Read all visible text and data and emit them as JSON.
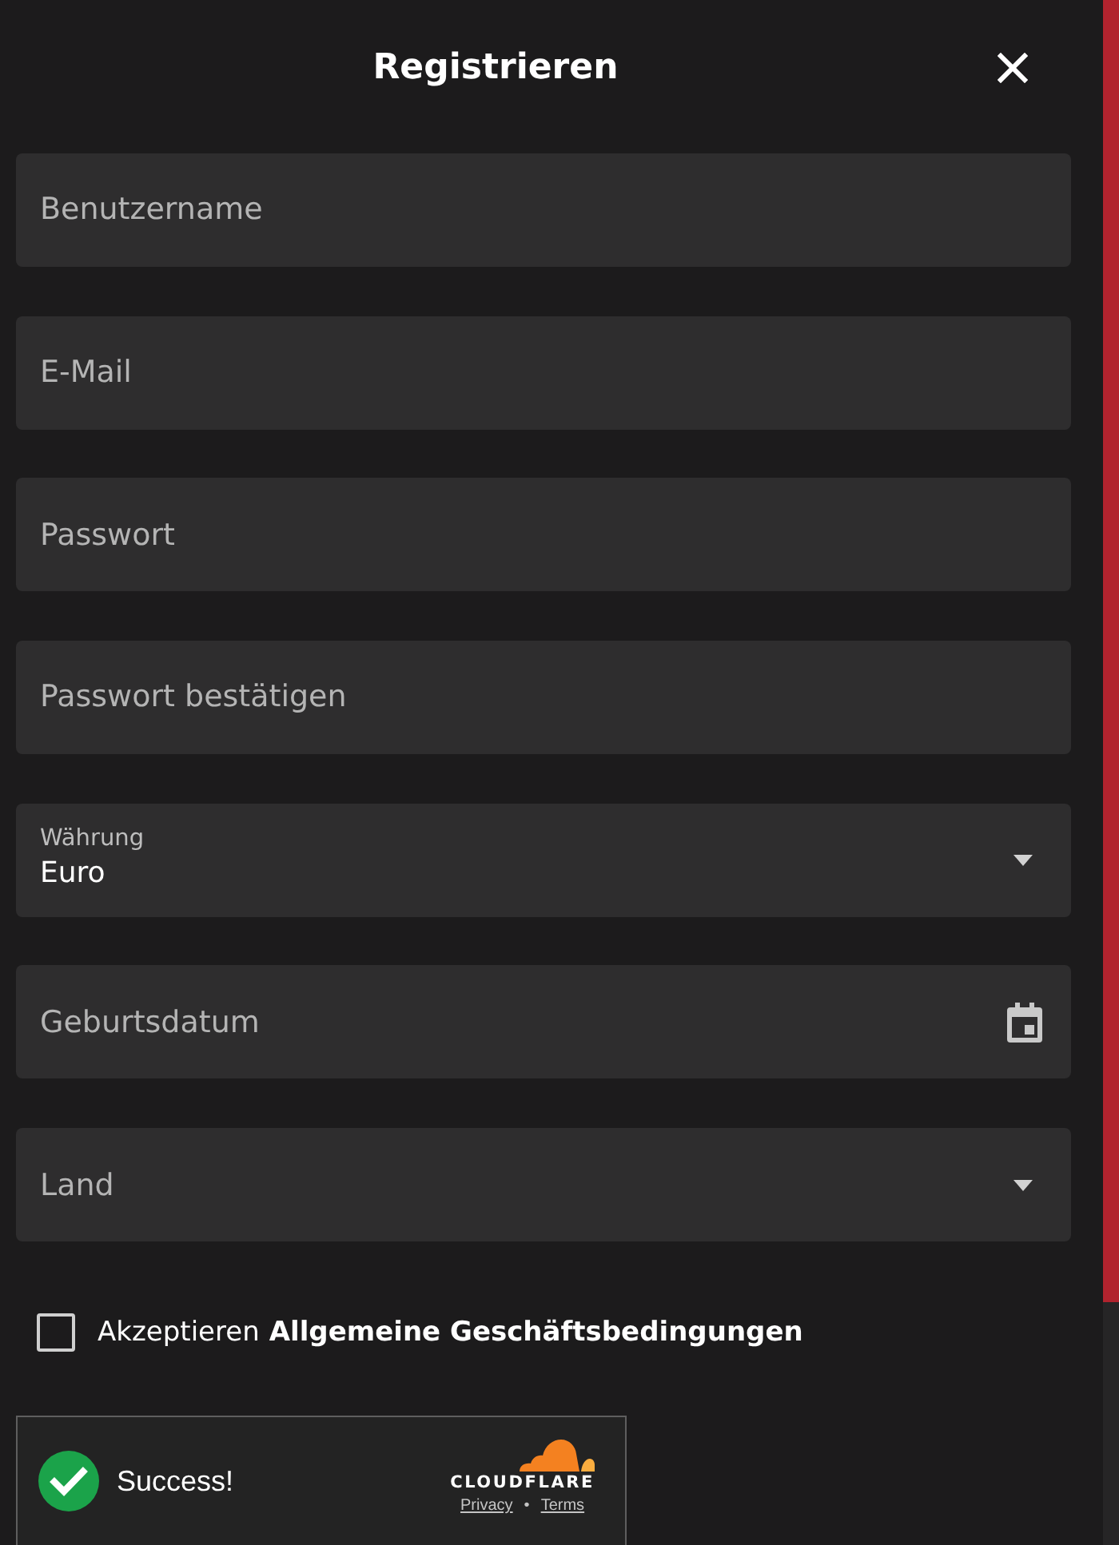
{
  "dialog": {
    "title": "Registrieren"
  },
  "fields": [
    {
      "kind": "text",
      "placeholder": "Benutzername"
    },
    {
      "kind": "email",
      "placeholder": "E-Mail"
    },
    {
      "kind": "password",
      "placeholder": "Passwort"
    },
    {
      "kind": "password",
      "placeholder": "Passwort bestätigen"
    },
    {
      "kind": "select",
      "label": "Währung",
      "value": "Euro"
    },
    {
      "kind": "date",
      "placeholder": "Geburtsdatum"
    },
    {
      "kind": "select",
      "placeholder": "Land"
    }
  ],
  "terms": {
    "checked": false,
    "label": "Akzeptieren",
    "link": "Allgemeine Geschäftsbedingungen"
  },
  "captcha": {
    "status": "Success!",
    "brand": "CLOUDFLARE",
    "links": [
      "Privacy",
      "Terms"
    ],
    "separator": "•"
  }
}
